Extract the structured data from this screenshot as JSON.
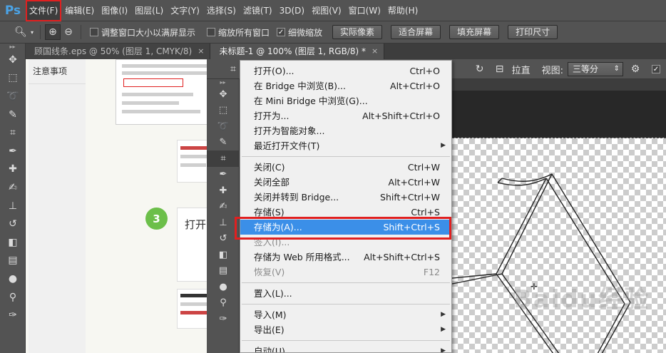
{
  "app": {
    "logo": "Ps"
  },
  "menubar": {
    "items": [
      "文件(F)",
      "编辑(E)",
      "图像(I)",
      "图层(L)",
      "文字(Y)",
      "选择(S)",
      "滤镜(T)",
      "3D(D)",
      "视图(V)",
      "窗口(W)",
      "帮助(H)"
    ],
    "active_index": 0
  },
  "optbar": {
    "check1_label": "调整窗口大小以满屏显示",
    "check2_label": "缩放所有窗口",
    "check3_label": "细微缩放",
    "check3_checked": true,
    "btn_actual": "实际像素",
    "btn_fit": "适合屏幕",
    "btn_fill": "填充屏幕",
    "btn_print": "打印尺寸"
  },
  "tabs": [
    {
      "label": "顾国线条.eps @ 50% (图层 1, CMYK/8)",
      "close": "×"
    },
    {
      "label": "未标题-1 @ 100% (图层 1, RGB/8) *",
      "close": "×"
    }
  ],
  "article": {
    "sidebar_note": "注意事项",
    "step_number": "3",
    "step_text": "打开"
  },
  "win2_options": {
    "straighten": "拉直",
    "view_label": "视图:",
    "view_value": "三等分"
  },
  "dropdown": {
    "items": [
      {
        "label": "打开(O)...",
        "shortcut": "Ctrl+O"
      },
      {
        "label": "在 Bridge 中浏览(B)...",
        "shortcut": "Alt+Ctrl+O"
      },
      {
        "label": "在 Mini Bridge 中浏览(G)...",
        "shortcut": ""
      },
      {
        "label": "打开为...",
        "shortcut": "Alt+Shift+Ctrl+O"
      },
      {
        "label": "打开为智能对象...",
        "shortcut": ""
      },
      {
        "label": "最近打开文件(T)",
        "shortcut": "",
        "submenu": true
      },
      {
        "sep": true
      },
      {
        "label": "关闭(C)",
        "shortcut": "Ctrl+W"
      },
      {
        "label": "关闭全部",
        "shortcut": "Alt+Ctrl+W"
      },
      {
        "label": "关闭并转到 Bridge...",
        "shortcut": "Shift+Ctrl+W"
      },
      {
        "label": "存储(S)",
        "shortcut": "Ctrl+S"
      },
      {
        "label": "存储为(A)...",
        "shortcut": "Shift+Ctrl+S",
        "highlight": true
      },
      {
        "label": "签入(I)...",
        "shortcut": "",
        "disabled": true
      },
      {
        "label": "存储为 Web 所用格式...",
        "shortcut": "Alt+Shift+Ctrl+S"
      },
      {
        "label": "恢复(V)",
        "shortcut": "F12",
        "disabled": true
      },
      {
        "sep": true
      },
      {
        "label": "置入(L)...",
        "shortcut": ""
      },
      {
        "sep": true
      },
      {
        "label": "导入(M)",
        "shortcut": "",
        "submenu": true
      },
      {
        "label": "导出(E)",
        "shortcut": "",
        "submenu": true
      },
      {
        "sep": true
      },
      {
        "label": "自动(U)",
        "shortcut": "",
        "submenu": true
      }
    ]
  },
  "watermark": "Baidu经验",
  "colors": {
    "highlight": "#3b8fe8",
    "annotation_red": "#e02020",
    "step_green": "#6cbf4a"
  },
  "icons": {
    "toolbar": [
      "move-icon",
      "marquee-icon",
      "lasso-icon",
      "quick-select-icon",
      "crop-icon",
      "eyedropper-icon",
      "healing-icon",
      "brush-icon",
      "stamp-icon",
      "history-brush-icon",
      "eraser-icon",
      "gradient-icon",
      "blur-icon",
      "dodge-icon",
      "pen-icon"
    ]
  }
}
